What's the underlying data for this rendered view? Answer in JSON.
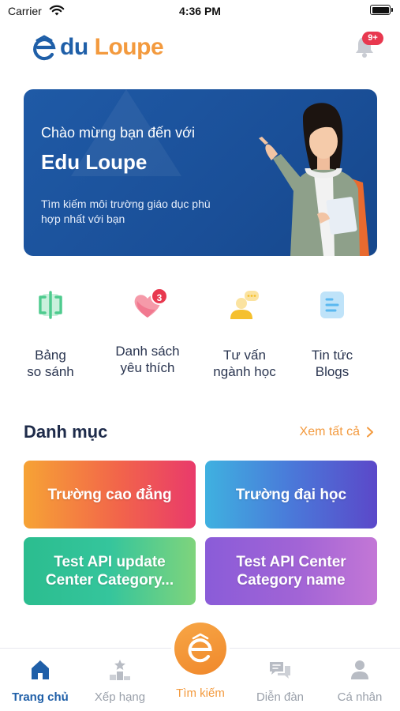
{
  "status_bar": {
    "carrier": "Carrier",
    "time": "4:36 PM"
  },
  "header": {
    "logo_text_1": "du",
    "logo_text_2": "Loupe",
    "notification_badge": "9+",
    "icons": [
      "logo-e-icon",
      "bell-icon"
    ]
  },
  "banner": {
    "welcome": "Chào mừng bạn đến với",
    "title": "Edu Loupe",
    "subtitle": "Tìm kiếm môi trường giáo dục phù hợp nhất với bạn"
  },
  "quick_actions": [
    {
      "label_line_1": "Bảng",
      "label_line_2": "so sánh",
      "icon": "compare-icon",
      "color": "#4ecb8e"
    },
    {
      "label_line_1": "Danh sách",
      "label_line_2": "yêu thích",
      "icon": "heart-icon",
      "color": "#f06b86",
      "badge": "3"
    },
    {
      "label_line_1": "Tư vấn",
      "label_line_2": "ngành học",
      "icon": "advice-icon",
      "color": "#f5c02e"
    },
    {
      "label_line_1": "Tin tức",
      "label_line_2": "Blogs",
      "icon": "blog-icon",
      "color": "#5ab8f0"
    }
  ],
  "categories": {
    "title": "Danh mục",
    "see_all": "Xem tất cả",
    "items": [
      {
        "label": "Trường cao đẳng"
      },
      {
        "label": "Trường đại học"
      },
      {
        "label": "Test API update Center Category..."
      },
      {
        "label": "Test API Center Category name"
      }
    ]
  },
  "tab_bar": {
    "tabs": [
      {
        "label": "Trang chủ",
        "icon": "home-icon",
        "active": true
      },
      {
        "label": "Xếp hạng",
        "icon": "ranking-icon"
      },
      {
        "label": "Tìm kiếm",
        "icon": "search-logo-icon"
      },
      {
        "label": "Diễn đàn",
        "icon": "forum-icon"
      },
      {
        "label": "Cá nhân",
        "icon": "profile-icon"
      }
    ]
  },
  "colors": {
    "brand_blue": "#1f5fa8",
    "brand_orange": "#f39a3e",
    "badge_red": "#e8384f"
  }
}
